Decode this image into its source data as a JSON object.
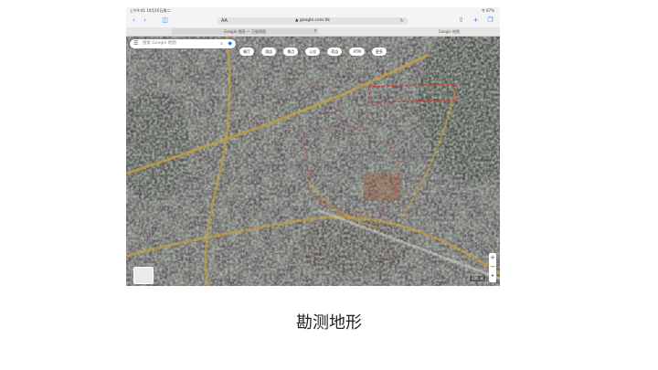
{
  "status_bar": {
    "left_text": "上午9:41 10月16日周二",
    "right_text": "令 87%"
  },
  "browser": {
    "aa_label": "AA",
    "url": "▲ google.com.hk",
    "tabs": [
      {
        "label": "Google 地图 — 卫星视图"
      },
      {
        "label": "Google 地图"
      }
    ]
  },
  "map": {
    "search_placeholder": "搜索 Google 地图",
    "chips": [
      "餐厅",
      "酒店",
      "景点",
      "公交",
      "药店",
      "ATM",
      "更多"
    ],
    "scale_label": "200 米"
  },
  "caption": "勘测地形",
  "colors": {
    "accent": "#3478f6",
    "route": "#c9a43a",
    "boundary": "#d23c3c"
  }
}
